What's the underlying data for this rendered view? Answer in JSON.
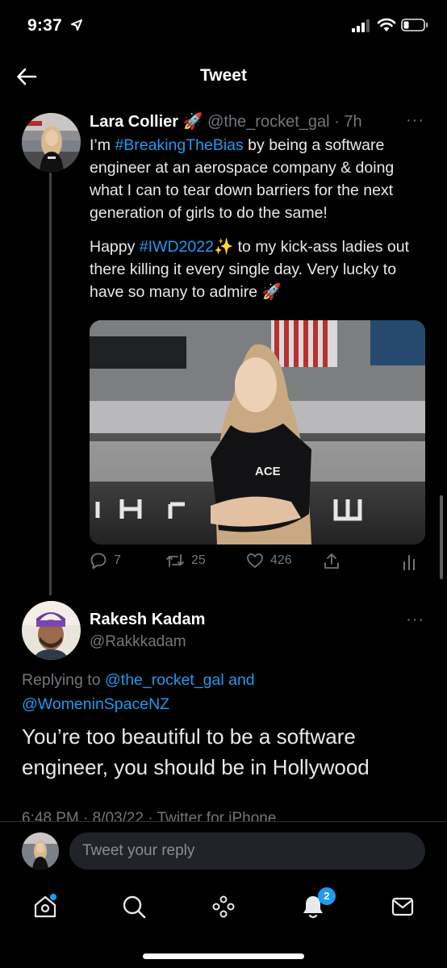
{
  "status": {
    "time": "9:37"
  },
  "nav": {
    "title": "Tweet"
  },
  "tweet": {
    "author_name": "Lara Collier",
    "author_emoji": "🚀",
    "author_handle": "@the_rocket_gal",
    "time_ago": "· 7h",
    "more": "···",
    "p1_a": "I’m ",
    "p1_hashtag": "#BreakingTheBias",
    "p1_b": " by being a software engineer at an aerospace company & doing what I can to tear down barriers for the next generation of girls to do the same!",
    "p2_a": "Happy ",
    "p2_hashtag": "#IWD2022",
    "p2_emoji": "✨",
    "p2_b": " to my kick-ass ladies out there killing it every single day. Very lucky to have so many to admire ",
    "p2_emoji2": "🚀",
    "replies": "7",
    "retweets": "25",
    "likes": "426"
  },
  "reply": {
    "author_name": "Rakesh Kadam",
    "author_handle": "@Rakkkadam",
    "more": "···",
    "replying_prefix": "Replying to ",
    "replying_user1": "@the_rocket_gal",
    "replying_and": " and",
    "replying_user2": "@WomeninSpaceNZ",
    "text": "You’re too beautiful to be a software engineer, you should be in Hollywood",
    "meta": "6:48 PM · 8/03/22 · Twitter for iPhone"
  },
  "composer": {
    "placeholder": "Tweet your reply"
  },
  "tabbar": {
    "notifications_badge": "2"
  },
  "colors": {
    "accent": "#1d9bf0",
    "muted": "#71767b",
    "background": "#000000"
  }
}
